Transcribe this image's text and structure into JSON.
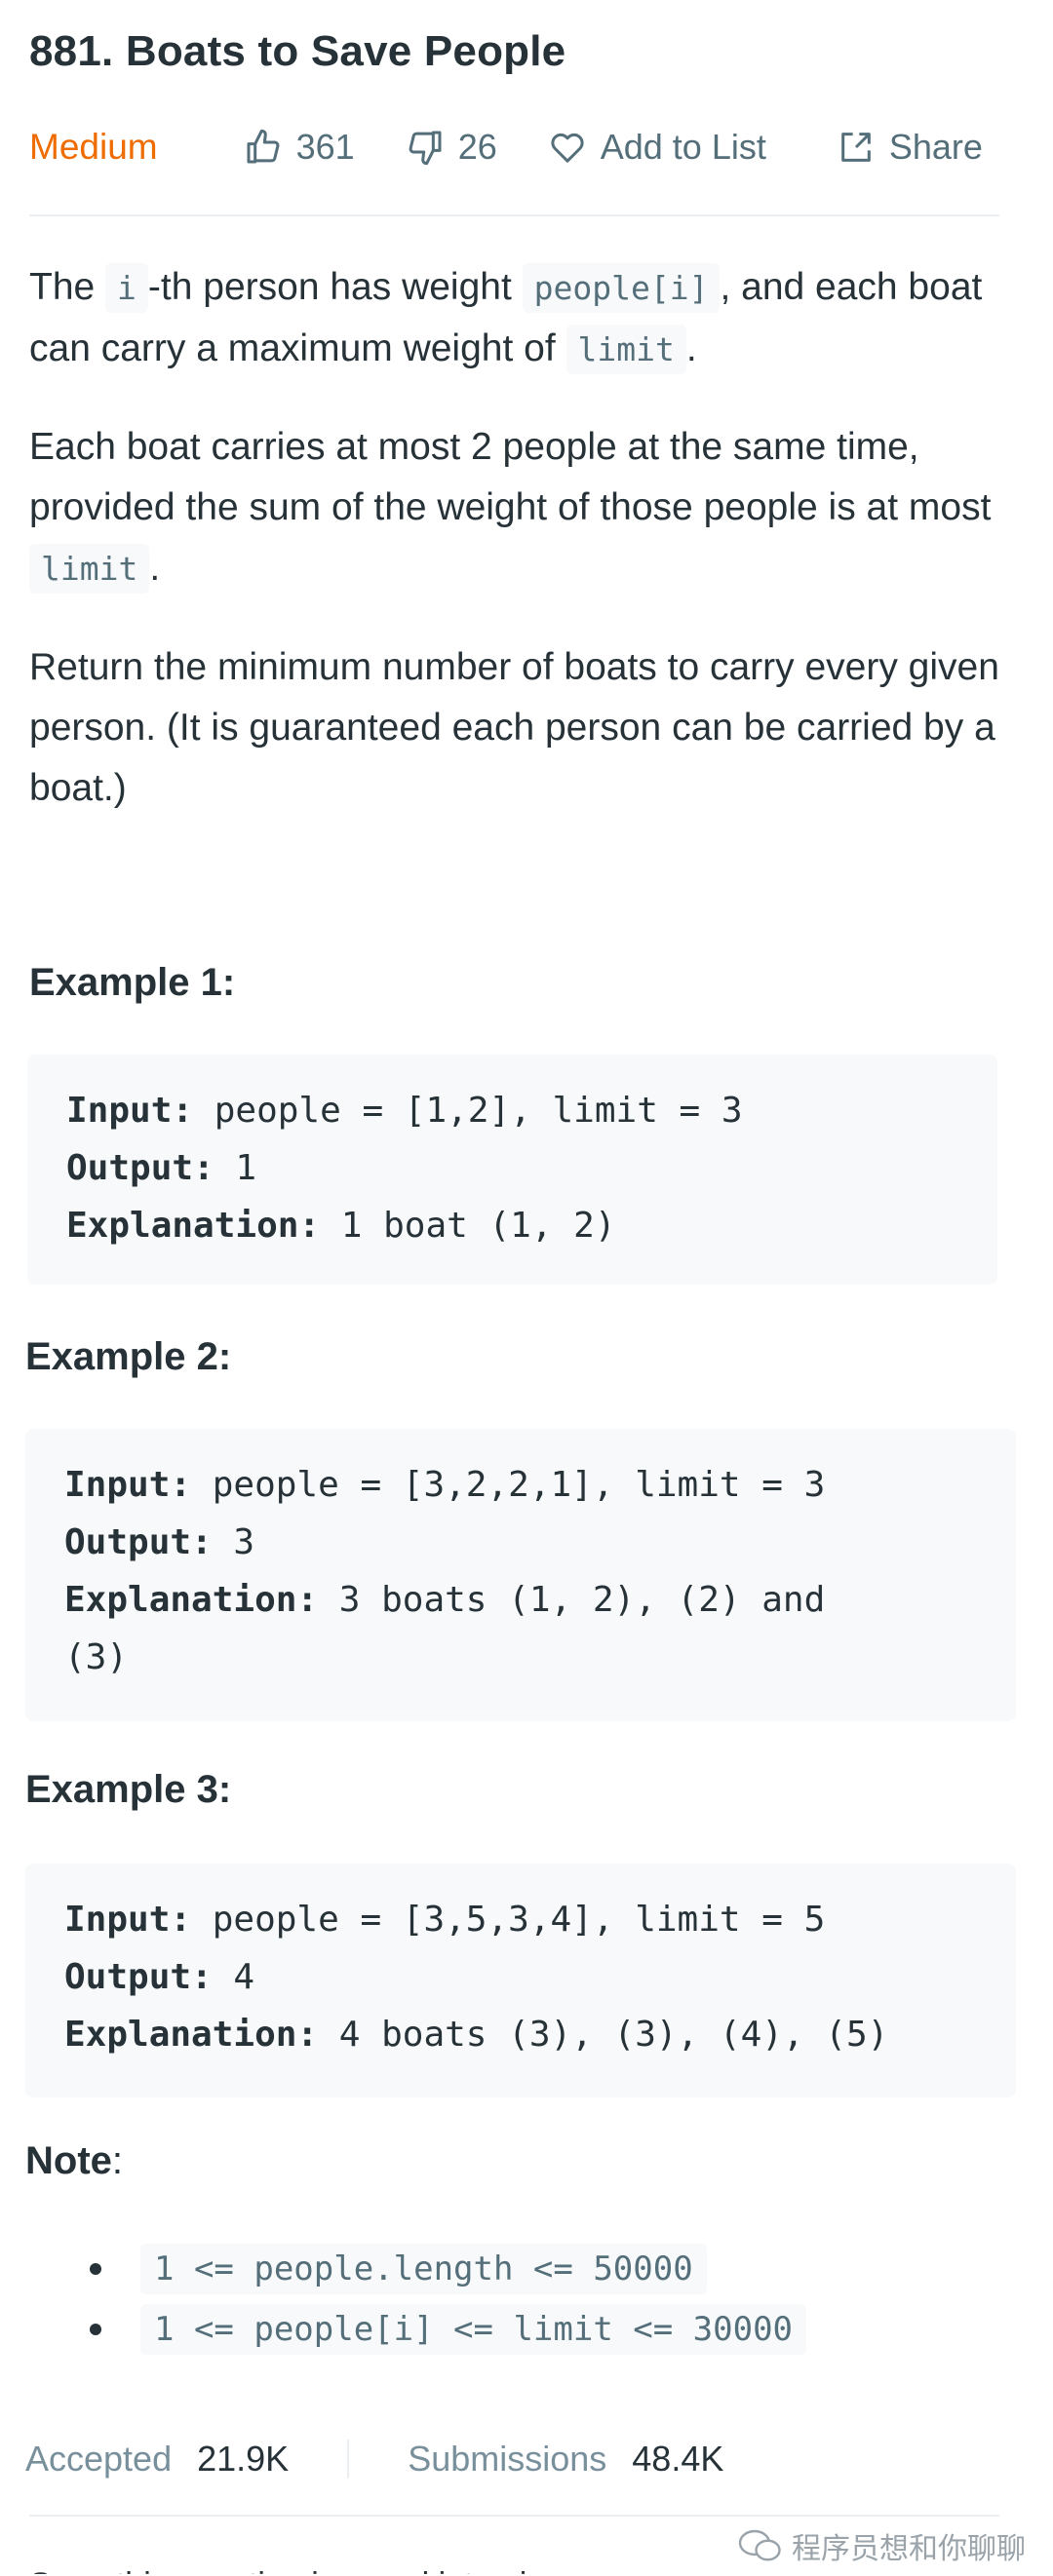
{
  "problem": {
    "title": "881. Boats to Save People",
    "difficulty": "Medium",
    "likes": "361",
    "dislikes": "26",
    "add_to_list_label": "Add to List",
    "share_label": "Share"
  },
  "description": {
    "p1": {
      "t1": "The ",
      "c1": "i",
      "t2": "-th person has weight ",
      "c2": "people[i]",
      "t3": ", and each boat can carry a maximum weight of ",
      "c3": "limit",
      "t4": "."
    },
    "p2": {
      "t1": "Each boat carries at most 2 people at the same time, provided the sum of the weight of those people is at most ",
      "c1": "limit",
      "t2": "."
    },
    "p3": "Return the minimum number of boats to carry every given person.  (It is guaranteed each person can be carried by a boat.)"
  },
  "examples": [
    {
      "title": "Example 1:",
      "input_label": "Input:",
      "input": " people = [1,2], limit = 3",
      "output_label": "Output:",
      "output": " 1",
      "explanation_label": "Explanation:",
      "explanation": " 1 boat (1, 2)"
    },
    {
      "title": "Example 2:",
      "input_label": "Input:",
      "input": " people = [3,2,2,1], limit = 3",
      "output_label": "Output:",
      "output": " 3",
      "explanation_label": "Explanation:",
      "explanation": " 3 boats (1, 2), (2) and",
      "explanation_cont": "(3)"
    },
    {
      "title": "Example 3:",
      "input_label": "Input:",
      "input": " people = [3,5,3,4], limit = 5",
      "output_label": "Output:",
      "output": " 4",
      "explanation_label": "Explanation:",
      "explanation": " 4 boats (3), (3), (4), (5)"
    }
  ],
  "note": {
    "label": "Note",
    "colon": ":",
    "items": [
      "1 <= people.length <= 50000",
      "1 <= people[i] <= limit <= 30000"
    ]
  },
  "stats": {
    "accepted_label": "Accepted",
    "accepted_value": "21.9K",
    "submissions_label": "Submissions",
    "submissions_value": "48.4K"
  },
  "watermark": "程序员想和你聊聊",
  "cut_off_text": "Seen this question in a real interview before?",
  "colors": {
    "difficulty_medium": "#ef6c00",
    "text": "#263238",
    "muted": "#546e7a",
    "code_bg": "#f7f9fa"
  }
}
